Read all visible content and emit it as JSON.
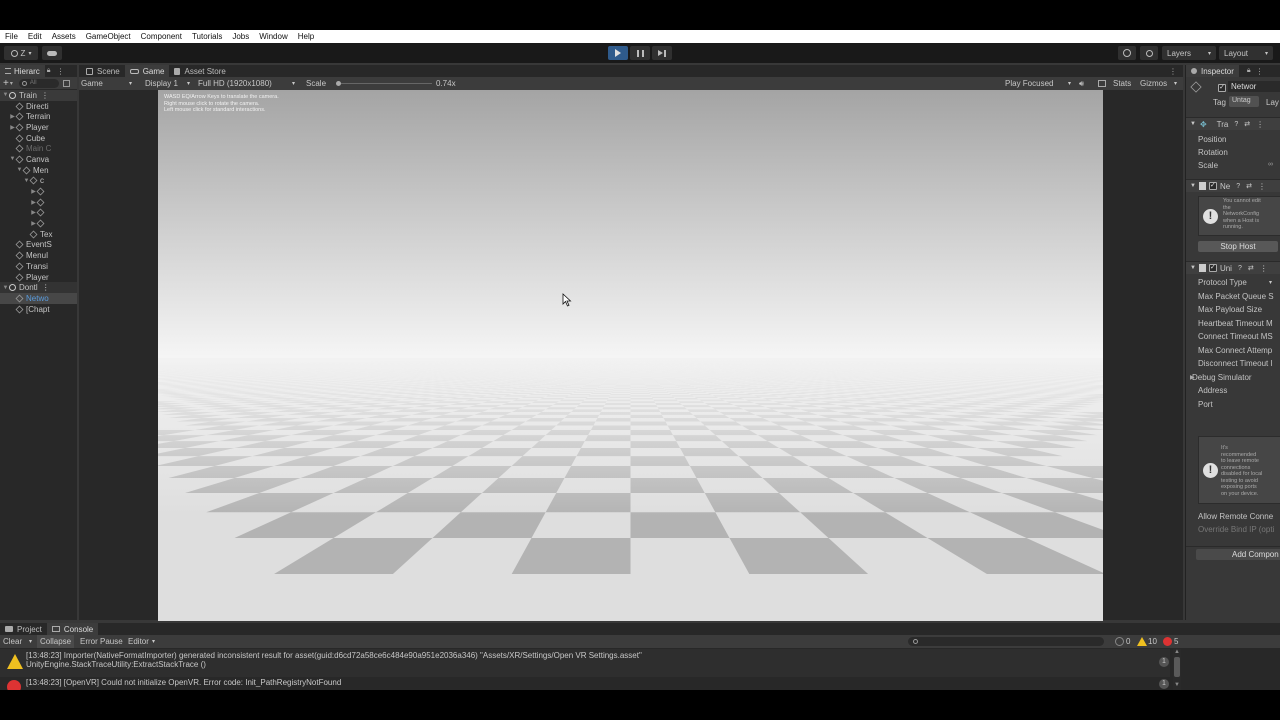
{
  "menu": [
    "File",
    "Edit",
    "Assets",
    "GameObject",
    "Component",
    "Tutorials",
    "Jobs",
    "Window",
    "Help"
  ],
  "toolbar": {
    "account_label": "Z",
    "layers_label": "Layers",
    "layout_label": "Layout"
  },
  "hierarchy": {
    "tab_label": "Hierarc",
    "search_placeholder": "All",
    "items": [
      {
        "label": "Train",
        "depth": 0,
        "arrow": "▼",
        "kind": "scene"
      },
      {
        "label": "Directi",
        "depth": 1,
        "arrow": "",
        "kind": "object"
      },
      {
        "label": "Terrain",
        "depth": 1,
        "arrow": "▶",
        "kind": "object"
      },
      {
        "label": "Player",
        "depth": 1,
        "arrow": "▶",
        "kind": "object"
      },
      {
        "label": "Cube",
        "depth": 1,
        "arrow": "",
        "kind": "object"
      },
      {
        "label": "Main C",
        "depth": 1,
        "arrow": "",
        "kind": "object",
        "dim": true
      },
      {
        "label": "Canva",
        "depth": 1,
        "arrow": "▼",
        "kind": "object"
      },
      {
        "label": "Men",
        "depth": 2,
        "arrow": "▼",
        "kind": "object"
      },
      {
        "label": "c",
        "depth": 3,
        "arrow": "▼",
        "kind": "object"
      },
      {
        "label": "",
        "depth": 4,
        "arrow": "▶",
        "kind": "object"
      },
      {
        "label": "",
        "depth": 4,
        "arrow": "▶",
        "kind": "object"
      },
      {
        "label": "",
        "depth": 4,
        "arrow": "▶",
        "kind": "object"
      },
      {
        "label": "",
        "depth": 4,
        "arrow": "▶",
        "kind": "object"
      },
      {
        "label": "Tex",
        "depth": 3,
        "arrow": "",
        "kind": "object"
      },
      {
        "label": "EventS",
        "depth": 1,
        "arrow": "",
        "kind": "object"
      },
      {
        "label": "MenuI",
        "depth": 1,
        "arrow": "",
        "kind": "object"
      },
      {
        "label": "Transi",
        "depth": 1,
        "arrow": "",
        "kind": "object"
      },
      {
        "label": "Player",
        "depth": 1,
        "arrow": "",
        "kind": "object"
      },
      {
        "label": "Dontl",
        "depth": 0,
        "arrow": "▼",
        "kind": "scene"
      },
      {
        "label": "Netwo",
        "depth": 1,
        "arrow": "",
        "kind": "object",
        "selected": true
      },
      {
        "label": "[Chapt",
        "depth": 1,
        "arrow": "",
        "kind": "object"
      }
    ]
  },
  "game": {
    "tabs": [
      "Scene",
      "Game",
      "Asset Store"
    ],
    "mode_select": "Game",
    "display_select": "Display 1",
    "resolution_select": "Full HD (1920x1080)",
    "scale_label": "Scale",
    "scale_value": "0.74x",
    "scale_fraction": 0,
    "play_mode": "Play Focused",
    "stats_label": "Stats",
    "gizmos_label": "Gizmos",
    "hint_lines": [
      "WASD EQ/Arrow Keys to translate the camera.",
      "Right mouse click to rotate the camera.",
      "Left mouse click for standard interactions."
    ]
  },
  "inspector": {
    "tab_label": "Inspector",
    "object_name": "Networ",
    "tag_label": "Tag",
    "tag_value": "Untag",
    "layer_label": "Lay",
    "transform": {
      "title": "Tra",
      "rows": [
        "Position",
        "Rotation",
        "Scale"
      ]
    },
    "network_manager": {
      "title": "Ne",
      "help": [
        "You cannot edit",
        "the",
        "NetworkConfig",
        "when a Host is",
        "running."
      ],
      "stop_button": "Stop Host"
    },
    "transport": {
      "title": "Uni",
      "rows": [
        "Protocol Type",
        "Max Packet Queue S",
        "Max Payload Size",
        "Heartbeat Timeout M",
        "Connect Timeout MS",
        "Max Connect Attemp",
        "Disconnect Timeout I",
        "Debug Simulator",
        "Address",
        "Port"
      ],
      "help": [
        "It's",
        "recommended",
        "to leave remote",
        "connections",
        "disabled for local",
        "testing to avoid",
        "exposing ports",
        "on your device."
      ],
      "rows_after": [
        "Allow Remote Conne",
        "Override Bind IP (opti"
      ]
    },
    "add_component": "Add Compon"
  },
  "console": {
    "tabs": [
      "Project",
      "Console"
    ],
    "buttons": [
      "Clear",
      "Collapse",
      "Error Pause",
      "Editor"
    ],
    "counts": {
      "info": "0",
      "warn": "10",
      "error": "5"
    },
    "logs": [
      {
        "type": "warning",
        "line1": "[13:48:23] Importer(NativeFormatImporter) generated inconsistent result for asset(guid:d6cd72a58ce6c484e90a951e2036a346) \"Assets/XR/Settings/Open VR Settings.asset\"",
        "line2": "UnityEngine.StackTraceUtility:ExtractStackTrace ()",
        "count": "1"
      },
      {
        "type": "error",
        "line1": "[13:48:23] [OpenVR] Could not initialize OpenVR. Error code: Init_PathRegistryNotFound",
        "line2": "",
        "count": "1"
      }
    ]
  },
  "colors": {
    "play_active": "#2f5b8c",
    "selection_blue": "#5a9cde",
    "warning": "#f0c020",
    "error": "#d33333"
  }
}
